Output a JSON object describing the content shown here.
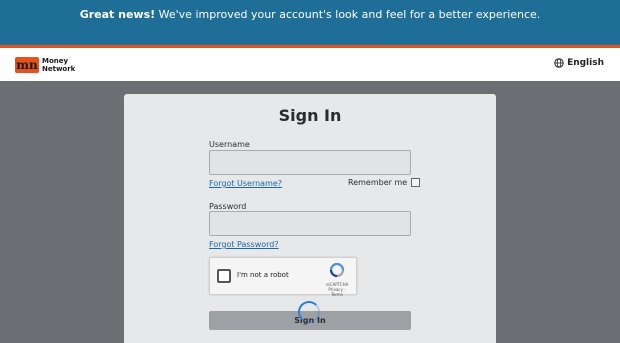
{
  "banner": {
    "bold": "Great news!",
    "message": " We've improved your account's look and feel for a better experience."
  },
  "header": {
    "logo_mark": "mn",
    "logo_line1": "Money",
    "logo_line2": "Network",
    "language": "English"
  },
  "form": {
    "title": "Sign In",
    "username_label": "Username",
    "username_value": "",
    "forgot_username": "Forgot Username?",
    "remember_me": "Remember me",
    "password_label": "Password",
    "password_value": "",
    "forgot_password": "Forgot Password?",
    "signin_label": "Sign In"
  },
  "recaptcha": {
    "label": "I'm not a robot",
    "brand": "reCAPTCHA",
    "links": "Privacy - Terms"
  },
  "colors": {
    "banner": "#1e6e98",
    "accent": "#e4521d",
    "link": "#1a6aa6"
  }
}
